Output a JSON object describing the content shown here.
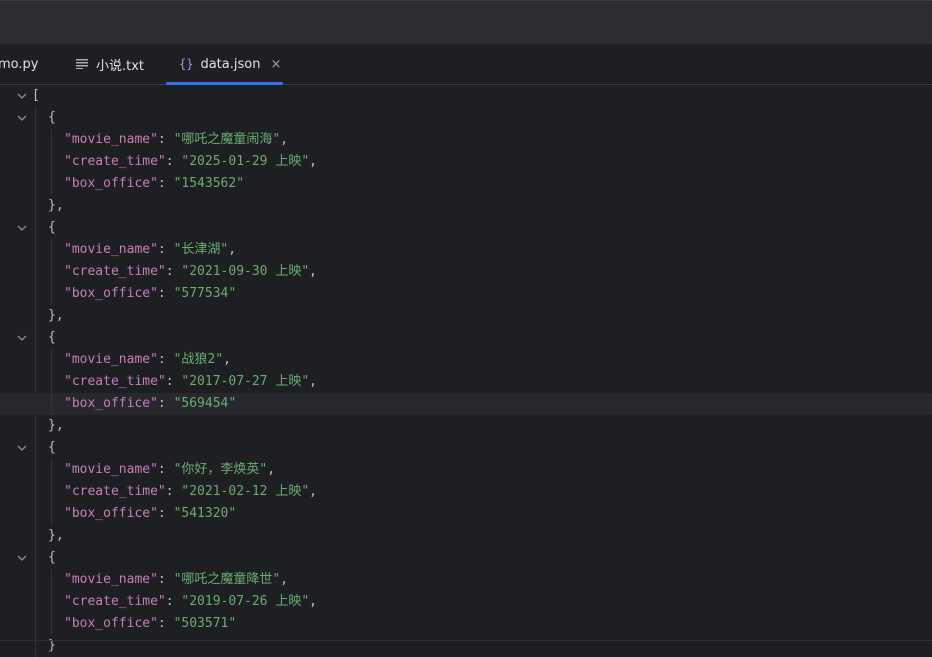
{
  "tabs": [
    {
      "label": "mo.py",
      "icon": "python-file-icon"
    },
    {
      "label": "小说.txt",
      "icon": "text-file-icon"
    },
    {
      "label": "data.json",
      "icon": "json-file-icon",
      "close": "×"
    }
  ],
  "editor": {
    "records": [
      {
        "name_key": "\"movie_name\"",
        "name_val": "\"哪吒之魔童闹海\"",
        "time_key": "\"create_time\"",
        "time_val": "\"2025-01-29 上映\"",
        "box_key": "\"box_office\"",
        "box_val": "\"1543562\""
      },
      {
        "name_key": "\"movie_name\"",
        "name_val": "\"长津湖\"",
        "time_key": "\"create_time\"",
        "time_val": "\"2021-09-30 上映\"",
        "box_key": "\"box_office\"",
        "box_val": "\"577534\""
      },
      {
        "name_key": "\"movie_name\"",
        "name_val": "\"战狼2\"",
        "time_key": "\"create_time\"",
        "time_val": "\"2017-07-27 上映\"",
        "box_key": "\"box_office\"",
        "box_val": "\"569454\""
      },
      {
        "name_key": "\"movie_name\"",
        "name_val": "\"你好，李焕英\"",
        "time_key": "\"create_time\"",
        "time_val": "\"2021-02-12 上映\"",
        "box_key": "\"box_office\"",
        "box_val": "\"541320\""
      },
      {
        "name_key": "\"movie_name\"",
        "name_val": "\"哪吒之魔童降世\"",
        "time_key": "\"create_time\"",
        "time_val": "\"2019-07-26 上映\"",
        "box_key": "\"box_office\"",
        "box_val": "\"503571\""
      }
    ],
    "punct": {
      "open_array": "[",
      "open_obj": "{",
      "close_obj": "},",
      "colon": ": ",
      "comma": ","
    },
    "partial_last": "}"
  }
}
